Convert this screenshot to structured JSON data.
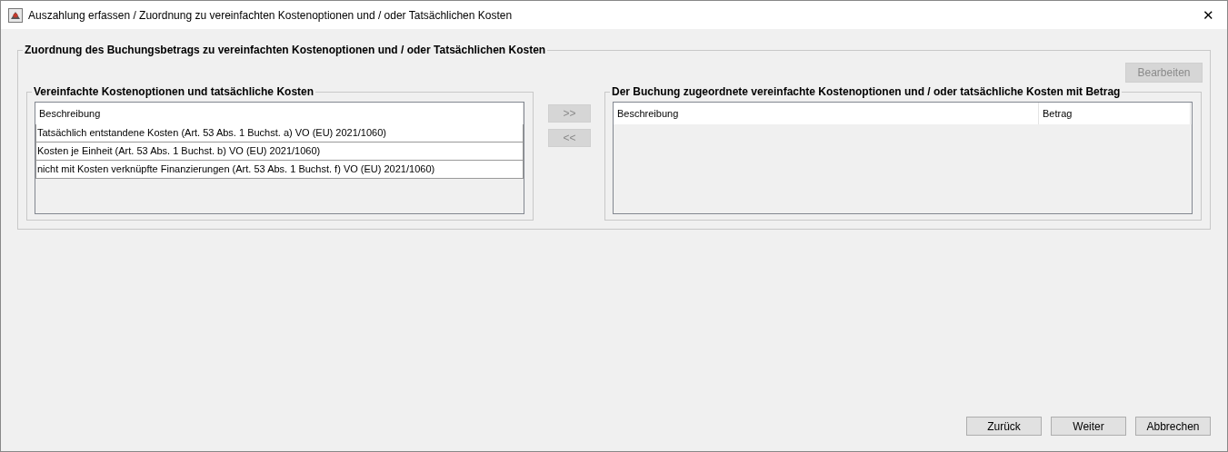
{
  "window": {
    "title": "Auszahlung erfassen / Zuordnung zu vereinfachten Kostenoptionen und / oder Tatsächlichen Kosten",
    "close": "✕"
  },
  "group": {
    "title": "Zuordnung des Buchungsbetrags zu vereinfachten Kostenoptionen und / oder Tatsächlichen Kosten",
    "edit_button": {
      "label": "Bearbeiten",
      "disabled": true
    },
    "available": {
      "title": "Vereinfachte Kostenoptionen und tatsächliche Kosten",
      "columns": [
        "Beschreibung"
      ],
      "rows": [
        {
          "text": "Tatsächlich entstandene Kosten (Art. 53 Abs. 1 Buchst. a) VO (EU) 2021/1060)",
          "selected": false
        },
        {
          "text": "Kosten je Einheit  (Art. 53 Abs. 1 Buchst. b) VO (EU) 2021/1060)",
          "selected": false
        },
        {
          "text": "nicht mit Kosten verknüpfte Finanzierungen (Art. 53 Abs. 1  Buchst. f) VO (EU) 2021/1060)",
          "selected": false
        }
      ]
    },
    "move_buttons": [
      {
        "label": ">>",
        "disabled": true
      },
      {
        "label": "<<",
        "disabled": true
      }
    ],
    "assigned": {
      "title": "Der Buchung zugeordnete vereinfachte Kostenoptionen und / oder tatsächliche Kosten mit Betrag",
      "columns": [
        "Beschreibung",
        "Betrag"
      ]
    }
  },
  "buttons": [
    {
      "label": "Zurück",
      "disabled": false
    },
    {
      "label": "Weiter",
      "disabled": false
    },
    {
      "label": "Abbrechen",
      "disabled": false
    }
  ]
}
